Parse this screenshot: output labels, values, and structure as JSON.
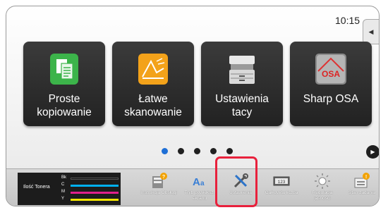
{
  "status": {
    "time": "10:15"
  },
  "side_tab": {
    "glyph": "◀"
  },
  "tiles": [
    {
      "line1": "Proste",
      "line2": "kopiowanie",
      "icon": "copy-document-icon"
    },
    {
      "line1": "Łatwe",
      "line2": "skanowanie",
      "icon": "scan-icon"
    },
    {
      "line1": "Ustawienia",
      "line2": "tacy",
      "icon": "printer-tray-icon"
    },
    {
      "line1": "Sharp OSA",
      "line2": "",
      "icon": "sharp-osa-icon"
    }
  ],
  "pager": {
    "pages": 5,
    "active_index": 0,
    "next_glyph": "▶"
  },
  "toner": {
    "title": "Ilość Tonera",
    "levels": [
      {
        "label": "Bk",
        "color": "#111111"
      },
      {
        "label": "C",
        "color": "#00b0f0"
      },
      {
        "label": "M",
        "color": "#e0208c"
      },
      {
        "label": "Y",
        "color": "#f2e400"
      }
    ]
  },
  "bottom_items": [
    {
      "label": "Instrukcja Obsługi",
      "icon": "manual-book-icon"
    },
    {
      "label": "Tryb powieksz. ekranu",
      "icon": "zoom-text-icon"
    },
    {
      "label": "Ustawienia",
      "icon": "tools-settings-icon"
    },
    {
      "label": "Całkowita liczba",
      "icon": "counter-display-icon"
    },
    {
      "label": "Regulacja jasności",
      "icon": "brightness-icon"
    },
    {
      "label": "Stan zadania",
      "icon": "job-status-icon"
    }
  ],
  "colors": {
    "highlight": "#e8213c",
    "active_dot": "#1e6fd6",
    "tile_bg": "#2b2b2b"
  }
}
